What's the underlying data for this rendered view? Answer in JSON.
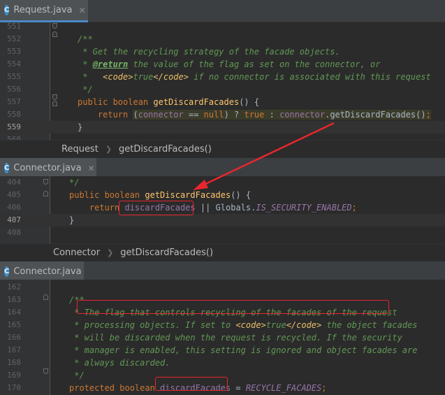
{
  "panes": [
    {
      "tab": {
        "label": "Request.java",
        "icon": "class-icon",
        "badge": "C",
        "close": "✕"
      },
      "lines": [
        {
          "n": "551",
          "tokens": []
        },
        {
          "n": "552",
          "tokens": [
            {
              "t": "/**",
              "c": "cmt"
            }
          ]
        },
        {
          "n": "553",
          "tokens": [
            {
              "t": " * Get the recycling strategy of the facade objects.",
              "c": "cmt"
            }
          ]
        },
        {
          "n": "554",
          "tokens": [
            {
              "t": " * ",
              "c": "cmt"
            },
            {
              "t": "@return",
              "c": "tag"
            },
            {
              "t": " the value of the flag as set on the connector, or",
              "c": "cmt"
            }
          ]
        },
        {
          "n": "555",
          "tokens": [
            {
              "t": " *   ",
              "c": "cmt"
            },
            {
              "t": "<code>",
              "c": "html"
            },
            {
              "t": "true",
              "c": "cmt"
            },
            {
              "t": "</code>",
              "c": "html"
            },
            {
              "t": " if no connector is associated with this request",
              "c": "cmt"
            }
          ]
        },
        {
          "n": "556",
          "tokens": [
            {
              "t": " */",
              "c": "cmt"
            }
          ]
        },
        {
          "n": "557",
          "tokens": [
            {
              "t": "public ",
              "c": "kw"
            },
            {
              "t": "boolean ",
              "c": "kw"
            },
            {
              "t": "getDiscardFacades",
              "c": "fn"
            },
            {
              "t": "() {",
              "c": ""
            }
          ]
        },
        {
          "n": "558",
          "tokens": [
            {
              "t": "    return ",
              "c": "kw"
            },
            {
              "t": "(",
              "c": "hl"
            },
            {
              "t": "connector",
              "c": "fld hl"
            },
            {
              "t": " == ",
              "c": "hl"
            },
            {
              "t": "null",
              "c": "kw hl"
            },
            {
              "t": ") ? ",
              "c": "hl"
            },
            {
              "t": "true",
              "c": "kw hl"
            },
            {
              "t": " : ",
              "c": "hl"
            },
            {
              "t": "connector",
              "c": "fld hl"
            },
            {
              "t": ".getDiscardFacades()",
              "c": "hl"
            },
            {
              "t": ";",
              "c": "kw hl"
            }
          ]
        },
        {
          "n": "559",
          "tokens": [
            {
              "t": "}",
              "c": ""
            }
          ]
        },
        {
          "n": "560",
          "tokens": []
        }
      ],
      "breadcrumb": [
        "Request",
        "getDiscardFacades()"
      ]
    },
    {
      "tab": {
        "label": "Connector.java",
        "icon": "class-icon",
        "badge": "C",
        "close": "✕"
      },
      "lines": [
        {
          "n": "404",
          "tokens": [
            {
              "t": "*/",
              "c": "cmt"
            }
          ]
        },
        {
          "n": "405",
          "tokens": [
            {
              "t": "public ",
              "c": "kw"
            },
            {
              "t": "boolean ",
              "c": "kw"
            },
            {
              "t": "getDiscardFacades",
              "c": "fn"
            },
            {
              "t": "() {",
              "c": ""
            }
          ]
        },
        {
          "n": "406",
          "tokens": [
            {
              "t": "    return ",
              "c": "kw"
            },
            {
              "t": "discardFacades",
              "c": "fld"
            },
            {
              "t": " || Globals.",
              "c": ""
            },
            {
              "t": "IS_SECURITY_ENABLED",
              "c": "sfld"
            },
            {
              "t": ";",
              "c": "kw"
            }
          ]
        },
        {
          "n": "407",
          "tokens": [
            {
              "t": "}",
              "c": ""
            }
          ]
        },
        {
          "n": "408",
          "tokens": []
        }
      ],
      "breadcrumb": [
        "Connector",
        "getDiscardFacades()"
      ]
    },
    {
      "tab": {
        "label": "Connector.java",
        "icon": "class-icon",
        "badge": "C",
        "close": ""
      },
      "lines": [
        {
          "n": "162",
          "tokens": []
        },
        {
          "n": "163",
          "tokens": [
            {
              "t": "/**",
              "c": "cmt"
            }
          ]
        },
        {
          "n": "164",
          "tokens": [
            {
              "t": " * The flag that controls recycling of the facades of the request",
              "c": "cmt"
            }
          ]
        },
        {
          "n": "165",
          "tokens": [
            {
              "t": " * processing objects. If set to ",
              "c": "cmt"
            },
            {
              "t": "<code>",
              "c": "html"
            },
            {
              "t": "true",
              "c": "cmt"
            },
            {
              "t": "</code>",
              "c": "html"
            },
            {
              "t": " the object facades",
              "c": "cmt"
            }
          ]
        },
        {
          "n": "166",
          "tokens": [
            {
              "t": " * will be discarded when the request is recycled. If the security",
              "c": "cmt"
            }
          ]
        },
        {
          "n": "167",
          "tokens": [
            {
              "t": " * manager is enabled, this setting is ignored and object facades are",
              "c": "cmt"
            }
          ]
        },
        {
          "n": "168",
          "tokens": [
            {
              "t": " * always discarded.",
              "c": "cmt"
            }
          ]
        },
        {
          "n": "169",
          "tokens": [
            {
              "t": " */",
              "c": "cmt"
            }
          ]
        },
        {
          "n": "170",
          "tokens": [
            {
              "t": "protected ",
              "c": "kw"
            },
            {
              "t": "boolean ",
              "c": "kw"
            },
            {
              "t": "discardFacades",
              "c": "fld"
            },
            {
              "t": " = ",
              "c": ""
            },
            {
              "t": "RECYCLE_FACADES",
              "c": "sfld"
            },
            {
              "t": ";",
              "c": "kw"
            }
          ]
        }
      ],
      "breadcrumb": []
    }
  ],
  "annotation_colors": {
    "box": "#e8262d",
    "arrow": "#e8262d"
  }
}
